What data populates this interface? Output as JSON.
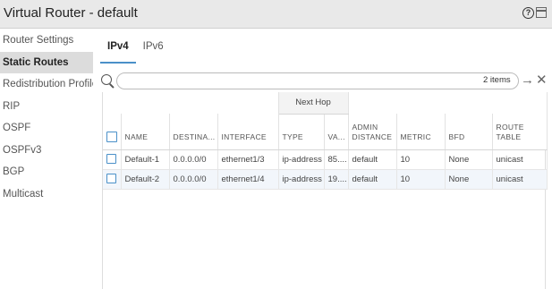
{
  "window": {
    "title": "Virtual Router - default"
  },
  "sidebar": {
    "items": [
      {
        "label": "Router Settings"
      },
      {
        "label": "Static Routes"
      },
      {
        "label": "Redistribution Profile"
      },
      {
        "label": "RIP"
      },
      {
        "label": "OSPF"
      },
      {
        "label": "OSPFv3"
      },
      {
        "label": "BGP"
      },
      {
        "label": "Multicast"
      }
    ],
    "active_index": 1
  },
  "tabs": [
    {
      "label": "IPv4"
    },
    {
      "label": "IPv6"
    }
  ],
  "search": {
    "placeholder": "",
    "count_label": "2 items"
  },
  "table": {
    "group_header": "Next Hop",
    "columns": [
      "NAME",
      "DESTINA...",
      "INTERFACE",
      "TYPE",
      "VA...",
      "ADMIN DISTANCE",
      "METRIC",
      "BFD",
      "ROUTE TABLE"
    ],
    "rows": [
      [
        "Default-1",
        "0.0.0.0/0",
        "ethernet1/3",
        "ip-address",
        "85....",
        "default",
        "10",
        "None",
        "unicast"
      ],
      [
        "Default-2",
        "0.0.0.0/0",
        "ethernet1/4",
        "ip-address",
        "19....",
        "default",
        "10",
        "None",
        "unicast"
      ]
    ]
  },
  "colors": {
    "accent": "#4a90c8",
    "active_sidebar": "#dcdcdc",
    "alt_row": "#f2f6fb"
  }
}
